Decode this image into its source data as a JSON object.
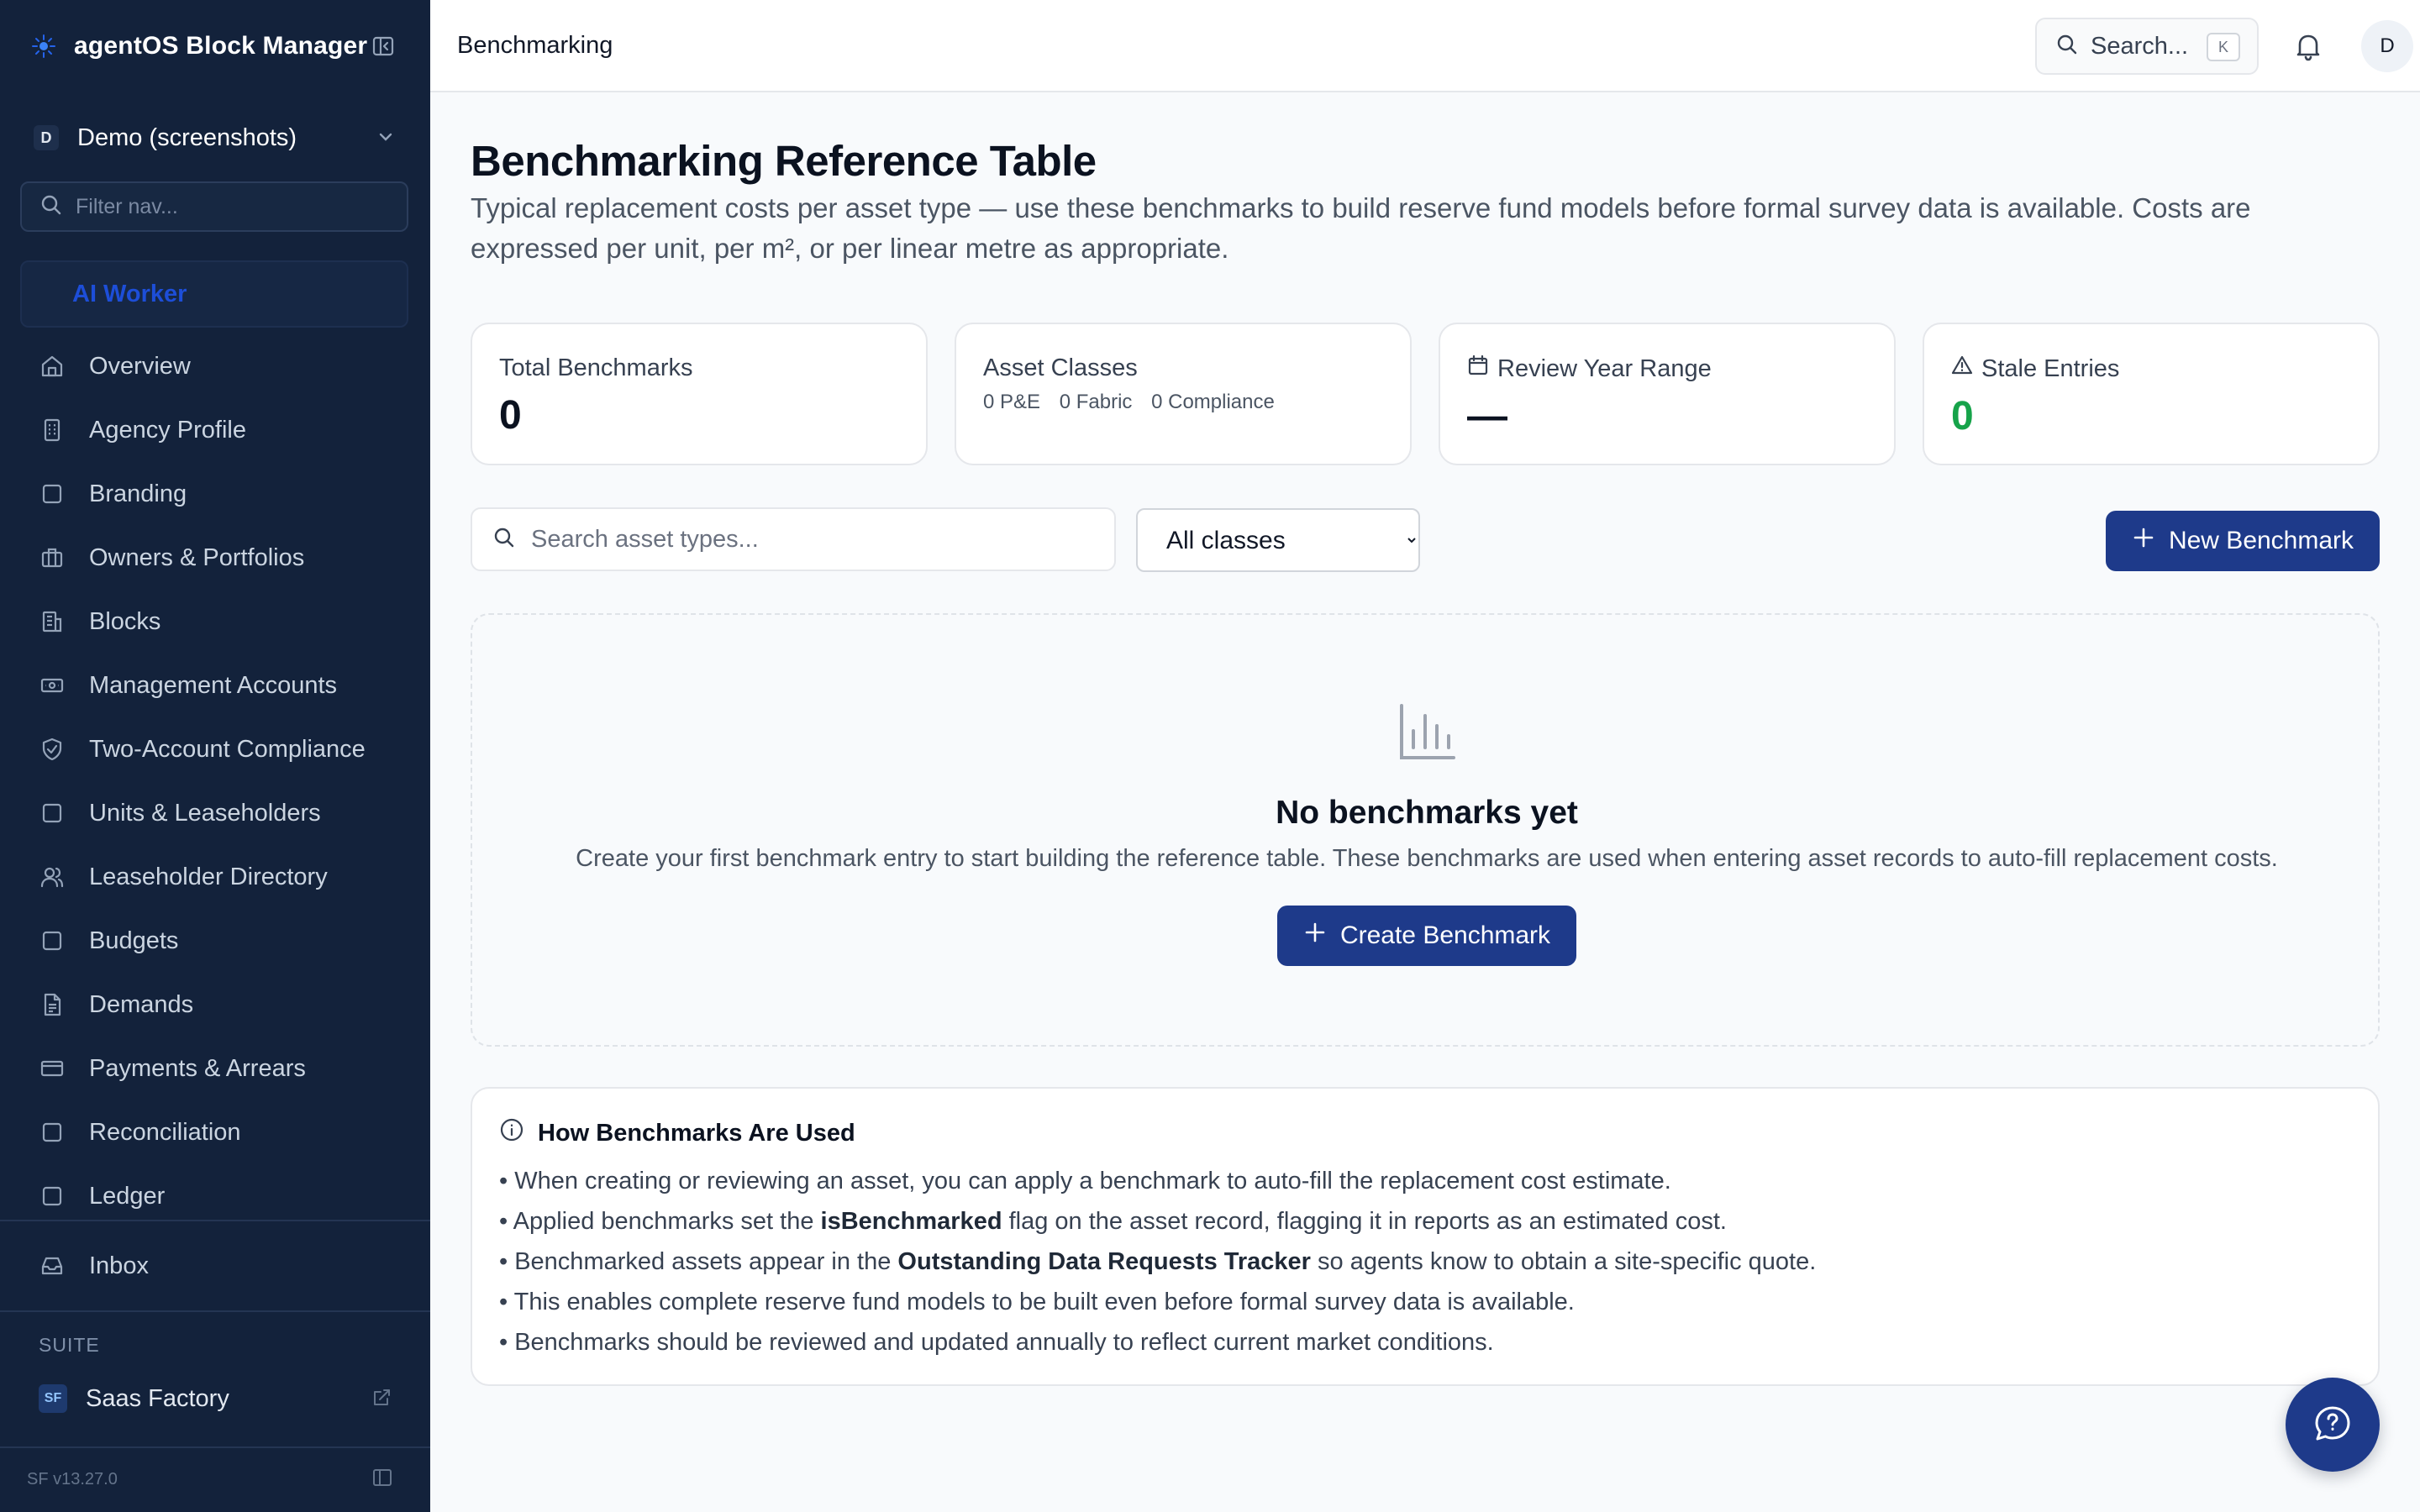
{
  "app": {
    "title": "agentOS Block Manager"
  },
  "workspace": {
    "badge": "D",
    "name": "Demo (screenshots)"
  },
  "nav_filter": {
    "placeholder": "Filter nav..."
  },
  "ai_worker": {
    "label": "AI Worker"
  },
  "sidebar": {
    "items": [
      {
        "label": "Overview",
        "icon": "home-icon"
      },
      {
        "label": "Agency Profile",
        "icon": "building-icon"
      },
      {
        "label": "Branding",
        "icon": "square-icon"
      },
      {
        "label": "Owners & Portfolios",
        "icon": "briefcase-icon"
      },
      {
        "label": "Blocks",
        "icon": "buildings-icon"
      },
      {
        "label": "Management Accounts",
        "icon": "banknote-icon"
      },
      {
        "label": "Two-Account Compliance",
        "icon": "shield-check-icon"
      },
      {
        "label": "Units & Leaseholders",
        "icon": "square-icon"
      },
      {
        "label": "Leaseholder Directory",
        "icon": "users-icon"
      },
      {
        "label": "Budgets",
        "icon": "square-icon"
      },
      {
        "label": "Demands",
        "icon": "file-text-icon"
      },
      {
        "label": "Payments & Arrears",
        "icon": "credit-card-icon"
      },
      {
        "label": "Reconciliation",
        "icon": "square-icon"
      },
      {
        "label": "Ledger",
        "icon": "square-icon"
      }
    ],
    "inbox": {
      "label": "Inbox",
      "icon": "inbox-icon"
    },
    "suite_label": "SUITE",
    "suite_item": {
      "badge": "SF",
      "label": "Saas Factory"
    },
    "version": "SF v13.27.0"
  },
  "topbar": {
    "title": "Benchmarking",
    "search_placeholder": "Search...",
    "search_shortcut": "K",
    "avatar": "D"
  },
  "page": {
    "title": "Benchmarking Reference Table",
    "description": "Typical replacement costs per asset type — use these benchmarks to build reserve fund models before formal survey data is available. Costs are expressed per unit, per m², or per linear metre as appropriate."
  },
  "stats": {
    "total": {
      "label": "Total Benchmarks",
      "value": "0"
    },
    "classes": {
      "label": "Asset Classes",
      "pe": "0 P&E",
      "fabric": "0 Fabric",
      "compliance": "0 Compliance"
    },
    "range": {
      "label": "Review Year Range",
      "value": "—"
    },
    "stale": {
      "label": "Stale Entries",
      "value": "0",
      "color": "#16a34a"
    }
  },
  "filters": {
    "search_placeholder": "Search asset types...",
    "class_options": [
      "All classes"
    ],
    "class_selected": "All classes",
    "new_button": "New Benchmark"
  },
  "empty": {
    "title": "No benchmarks yet",
    "description": "Create your first benchmark entry to start building the reference table. These benchmarks are used when entering asset records to auto-fill replacement costs.",
    "button": "Create Benchmark"
  },
  "info": {
    "title": "How Benchmarks Are Used",
    "line1": "• When creating or reviewing an asset, you can apply a benchmark to auto-fill the replacement cost estimate.",
    "line2_pre": "• Applied benchmarks set the ",
    "line2_bold": "isBenchmarked",
    "line2_post": " flag on the asset record, flagging it in reports as an estimated cost.",
    "line3_pre": "• Benchmarked assets appear in the ",
    "line3_bold": "Outstanding Data Requests Tracker",
    "line3_post": " so agents know to obtain a site-specific quote.",
    "line4": "• This enables complete reserve fund models to be built even before formal survey data is available.",
    "line5": "• Benchmarks should be reviewed and updated annually to reflect current market conditions."
  },
  "colors": {
    "sidebar_bg": "#13223b",
    "primary": "#1e3a8a",
    "success": "#16a34a"
  }
}
